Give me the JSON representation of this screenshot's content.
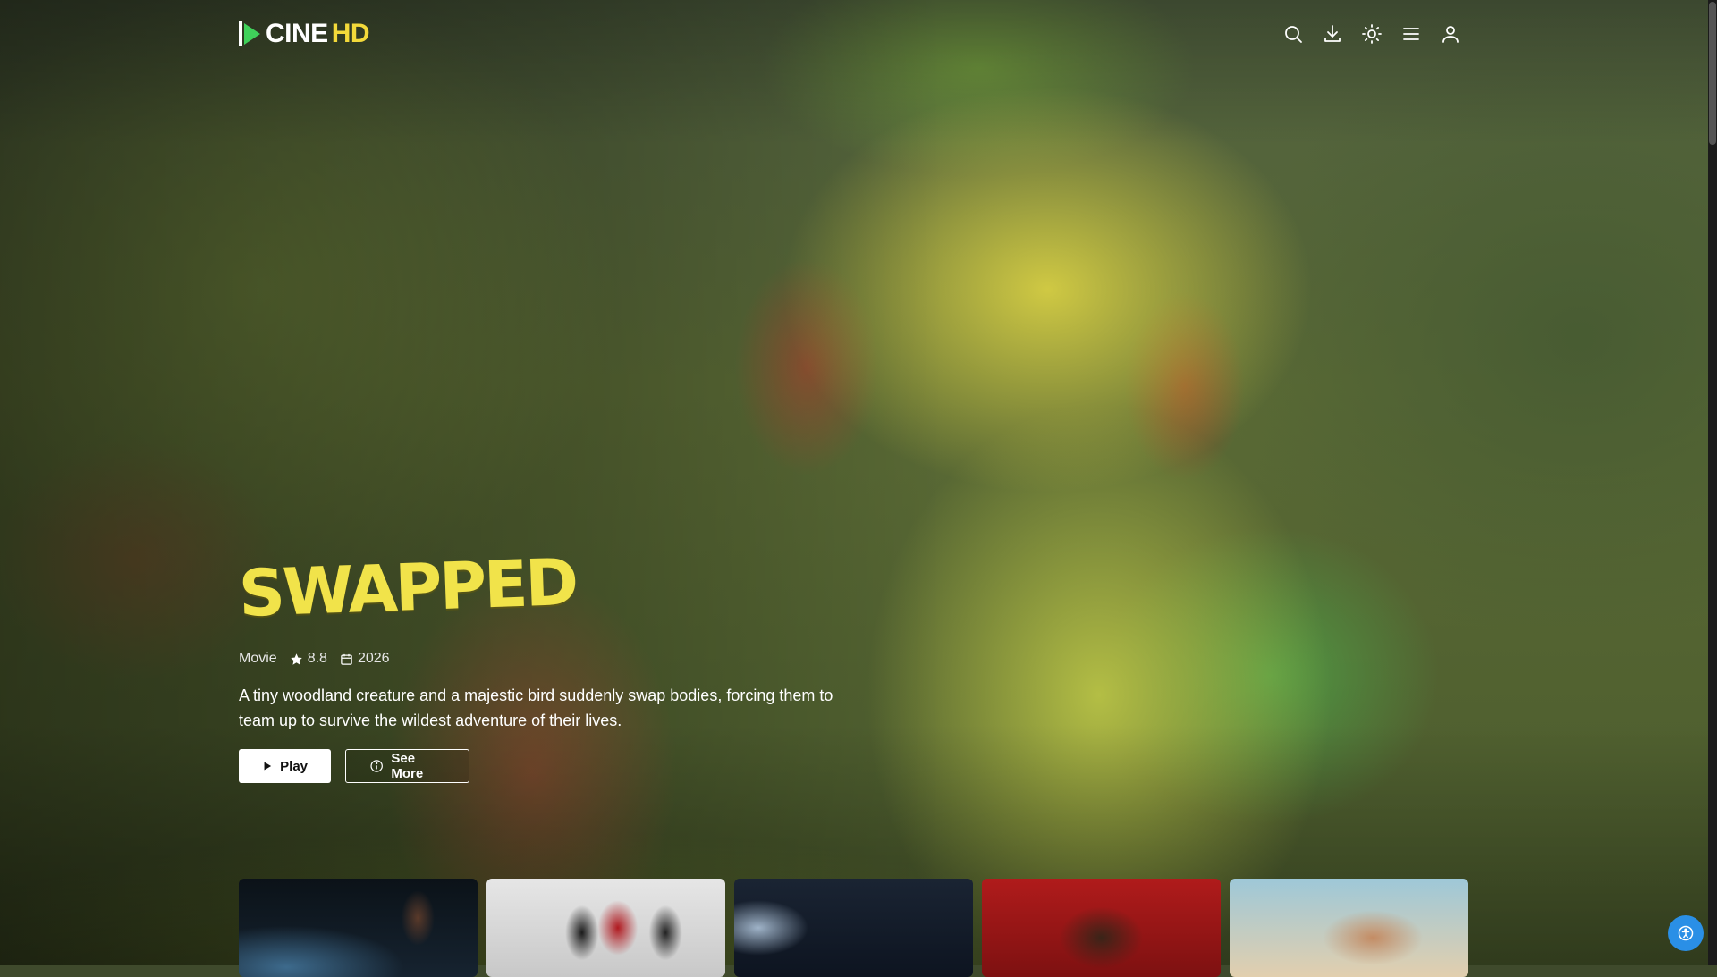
{
  "brand": {
    "name_main": "CINE",
    "name_accent": "HD",
    "accent_color": "#f3d93a"
  },
  "nav": {
    "icons": [
      "search-icon",
      "download-icon",
      "theme-toggle-icon",
      "menu-icon",
      "user-icon"
    ]
  },
  "hero": {
    "title": "SWAPPED",
    "type": "Movie",
    "rating": "8.8",
    "year": "2026",
    "description": "A tiny woodland creature and a majestic bird suddenly swap bodies, forcing them to team up to survive the wildest adventure of their lives.",
    "play_label": "Play",
    "more_label": "See More"
  },
  "row": {
    "items": [
      {
        "name": "row-thumbnail-1"
      },
      {
        "name": "row-thumbnail-2"
      },
      {
        "name": "row-thumbnail-3"
      },
      {
        "name": "row-thumbnail-4"
      },
      {
        "name": "row-thumbnail-5"
      }
    ]
  },
  "fab": {
    "icon": "accessibility-icon",
    "color": "#2a8fe6"
  }
}
